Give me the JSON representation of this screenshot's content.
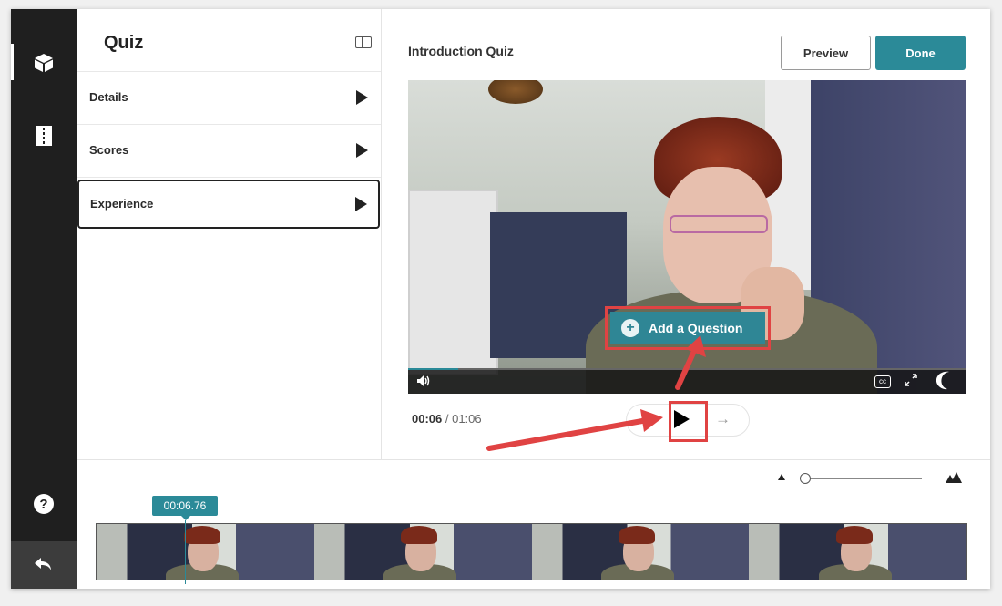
{
  "panel": {
    "title": "Quiz",
    "items": [
      {
        "label": "Details"
      },
      {
        "label": "Scores"
      },
      {
        "label": "Experience"
      }
    ]
  },
  "main": {
    "title": "Introduction Quiz",
    "preview_label": "Preview",
    "done_label": "Done"
  },
  "video": {
    "add_question_label": "Add a Question",
    "current_time": "00:06",
    "separator": " / ",
    "duration": "01:06",
    "cc_label": "cc",
    "progress_fraction": 0.09
  },
  "timeline": {
    "playhead_time": "00:06.76"
  },
  "colors": {
    "accent": "#2b8a98",
    "rail": "#1f1f1f",
    "annotation": "#e04343"
  },
  "icons": {
    "rail_top": "cube-icon",
    "rail_second": "film-icon",
    "rail_help": "help-icon",
    "rail_back": "undo-icon"
  }
}
